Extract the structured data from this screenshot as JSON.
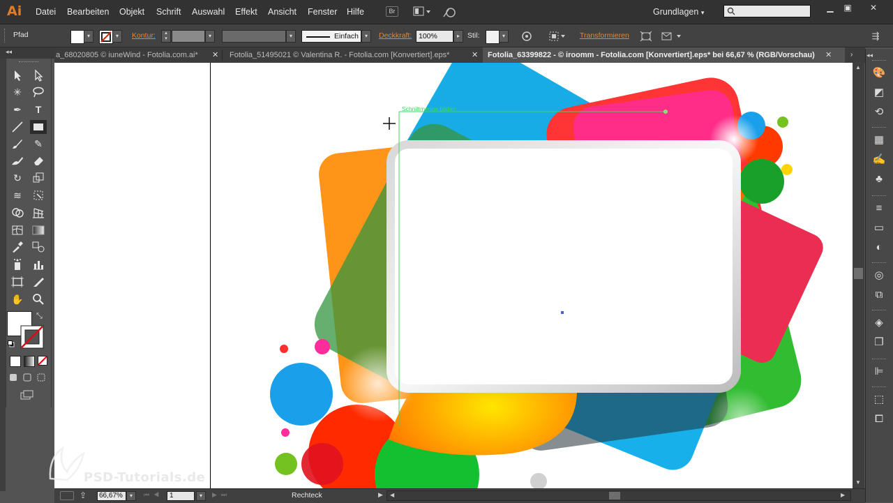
{
  "app": {
    "logo": "Ai",
    "menu": [
      "Datei",
      "Bearbeiten",
      "Objekt",
      "Schrift",
      "Auswahl",
      "Effekt",
      "Ansicht",
      "Fenster",
      "Hilfe"
    ],
    "bridge_label": "Br",
    "workspace": "Grundlagen",
    "search_placeholder": ""
  },
  "control_bar": {
    "selection_type": "Pfad",
    "kontur_label": "Kontur:",
    "stroke_style": "Einfach",
    "deckkraft_label": "Deckkraft:",
    "deckkraft_value": "100%",
    "stil_label": "Stil:",
    "transformieren_label": "Transformieren"
  },
  "tabs": [
    {
      "label": "a_68020805 © iuneWind - Fotolia.com.ai*",
      "active": false
    },
    {
      "label": "Fotolia_51495021 © Valentina R. - Fotolia.com [Konvertiert].eps*",
      "active": false
    },
    {
      "label": "Fotolia_63399822 - © iroomm - Fotolia.com [Konvertiert].eps* bei 66,67 % (RGB/Vorschau)",
      "active": true
    }
  ],
  "canvas": {
    "smart_guide_label": "Schnittmenge bilden"
  },
  "status_bar": {
    "zoom": "66,67%",
    "page": "1",
    "current_tool": "Rechteck"
  },
  "watermark": "PSD-Tutorials.de",
  "colors": {
    "accent_orange": "#e5882f",
    "smart_guide_green": "#3fd65c",
    "selection_blue": "#3c66d8"
  },
  "icons": {
    "tools": [
      "selection-tool-icon",
      "direct-selection-tool-icon",
      "magic-wand-icon",
      "lasso-icon",
      "pen-tool-icon",
      "type-tool-icon",
      "line-tool-icon",
      "rectangle-tool-icon",
      "paintbrush-icon",
      "pencil-icon",
      "blob-brush-icon",
      "eraser-icon",
      "rotate-tool-icon",
      "scale-tool-icon",
      "width-tool-icon",
      "free-transform-icon",
      "shape-builder-icon",
      "perspective-grid-icon",
      "mesh-tool-icon",
      "gradient-tool-icon",
      "eyedropper-icon",
      "blend-tool-icon",
      "symbol-sprayer-icon",
      "graph-tool-icon",
      "artboard-tool-icon",
      "slice-tool-icon",
      "hand-tool-icon",
      "zoom-tool-icon"
    ]
  }
}
